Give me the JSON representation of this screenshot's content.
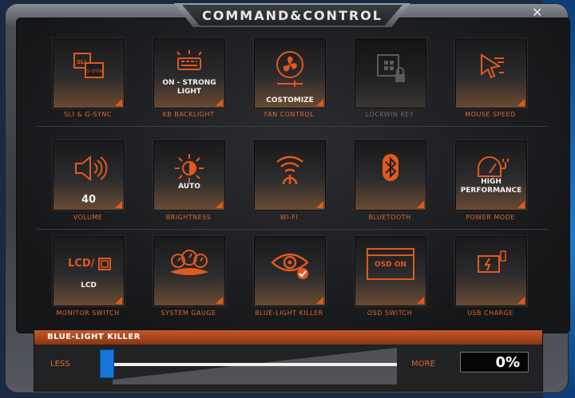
{
  "window": {
    "title": "COMMAND&CONTROL",
    "close_glyph": "✕"
  },
  "tiles": [
    {
      "id": "sli",
      "label": "SLI & G-SYNC",
      "icon": "sli-gsync-icon",
      "state": "",
      "enabled": true
    },
    {
      "id": "kb",
      "label": "KB BACKLIGHT",
      "icon": "keyboard-backlight-icon",
      "state": "ON - STRONG LIGHT",
      "enabled": true
    },
    {
      "id": "fan",
      "label": "FAN CONTROL",
      "icon": "fan-icon",
      "state": "COSTOMIZE",
      "enabled": true
    },
    {
      "id": "lock",
      "label": "LOCKWIN KEY",
      "icon": "lockwin-icon",
      "state": "",
      "enabled": false
    },
    {
      "id": "mouse",
      "label": "MOUSE SPEED",
      "icon": "mouse-cursor-icon",
      "state": "",
      "enabled": true
    },
    {
      "id": "vol",
      "label": "VOLUME",
      "icon": "speaker-icon",
      "state": "40",
      "enabled": true
    },
    {
      "id": "bright",
      "label": "BRIGHTNESS",
      "icon": "sun-icon",
      "state": "AUTO",
      "enabled": true
    },
    {
      "id": "wifi",
      "label": "WI-FI",
      "icon": "wifi-icon",
      "state": "",
      "enabled": true
    },
    {
      "id": "bt",
      "label": "BLUETOOTH",
      "icon": "bluetooth-icon",
      "state": "",
      "enabled": true
    },
    {
      "id": "power",
      "label": "POWER MODE",
      "icon": "power-gauge-icon",
      "state": "HIGH PERFORMANCE",
      "enabled": true
    },
    {
      "id": "monitor",
      "label": "MONITOR SWITCH",
      "icon": "monitor-switch-icon",
      "state": "LCD",
      "icon_text": "LCD/",
      "enabled": true
    },
    {
      "id": "gauge",
      "label": "SYSTEM GAUGE",
      "icon": "gauges-icon",
      "state": "",
      "enabled": true
    },
    {
      "id": "blue",
      "label": "BLUE-LIGHT KILLER",
      "icon": "eye-icon",
      "state": "",
      "enabled": true
    },
    {
      "id": "osd",
      "label": "OSD SWITCH",
      "icon": "osd-icon",
      "state": "",
      "icon_text": "OSD ON",
      "enabled": true
    },
    {
      "id": "usb",
      "label": "USB CHARGE",
      "icon": "usb-charge-icon",
      "state": "",
      "enabled": true
    }
  ],
  "panel": {
    "title": "BLUE-LIGHT KILLER",
    "less": "LESS",
    "more": "MORE",
    "value_text": "0%",
    "value": 0
  },
  "colors": {
    "accent": "#e05a1c",
    "label": "#e06a2a",
    "thumb": "#1575d9"
  }
}
